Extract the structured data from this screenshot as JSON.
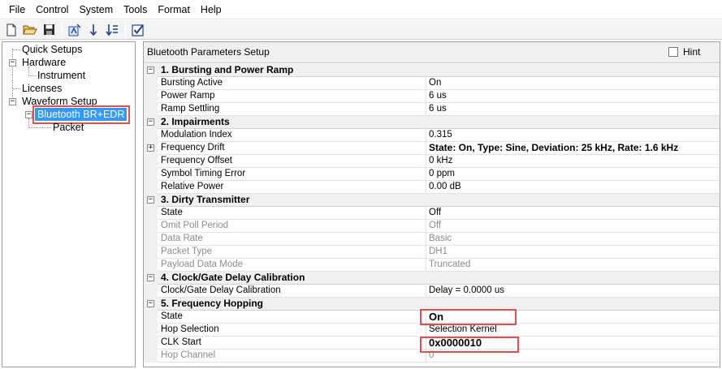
{
  "menu": {
    "items": [
      "File",
      "Control",
      "System",
      "Tools",
      "Format",
      "Help"
    ]
  },
  "toolbar": {
    "buttons": [
      "new-file-icon",
      "open-folder-icon",
      "save-icon",
      "wizard-icon",
      "sort-down-icon",
      "sort-list-icon",
      "checklist-icon"
    ]
  },
  "tree": {
    "quick_setups": "Quick Setups",
    "hardware": "Hardware",
    "instrument": "Instrument",
    "licenses": "Licenses",
    "waveform_setup": "Waveform Setup",
    "bluetooth": "Bluetooth BR+EDR",
    "packet": "Packet"
  },
  "panel": {
    "title": "Bluetooth Parameters Setup",
    "hint_label": "Hint"
  },
  "sections": [
    {
      "title": "1. Bursting and Power Ramp",
      "rows": [
        {
          "name": "Bursting Active",
          "value": "On"
        },
        {
          "name": "Power Ramp",
          "value": "6 us"
        },
        {
          "name": "Ramp Settling",
          "value": "6 us"
        }
      ]
    },
    {
      "title": "2. Impairments",
      "rows": [
        {
          "name": "Modulation Index",
          "value": "0.315"
        },
        {
          "name": "Frequency Drift",
          "value": "State: On, Type: Sine, Deviation: 25 kHz, Rate: 1.6 kHz"
        },
        {
          "name": "Frequency Offset",
          "value": "0 kHz"
        },
        {
          "name": "Symbol Timing Error",
          "value": "0 ppm"
        },
        {
          "name": "Relative Power",
          "value": "0.00 dB"
        }
      ]
    },
    {
      "title": "3. Dirty Transmitter",
      "rows": [
        {
          "name": "State",
          "value": "Off"
        },
        {
          "name": "Omit Poll Period",
          "value": "Off"
        },
        {
          "name": "Data Rate",
          "value": "Basic"
        },
        {
          "name": "Packet Type",
          "value": "DH1"
        },
        {
          "name": "Payload Data Mode",
          "value": "Truncated"
        }
      ]
    },
    {
      "title": "4. Clock/Gate Delay Calibration",
      "rows": [
        {
          "name": "Clock/Gate Delay Calibration",
          "value": "Delay = 0.0000 us"
        }
      ]
    },
    {
      "title": "5. Frequency Hopping",
      "rows": [
        {
          "name": "State",
          "value": "On"
        },
        {
          "name": "Hop Selection",
          "value": "Selection Kernel"
        },
        {
          "name": "CLK Start",
          "value": "0x0000010"
        },
        {
          "name": "Hop Channel",
          "value": "0"
        }
      ]
    }
  ],
  "colors": {
    "selection": "#3399ff",
    "highlight_box": "#e05050",
    "disabled_text": "#8c8c8c"
  }
}
